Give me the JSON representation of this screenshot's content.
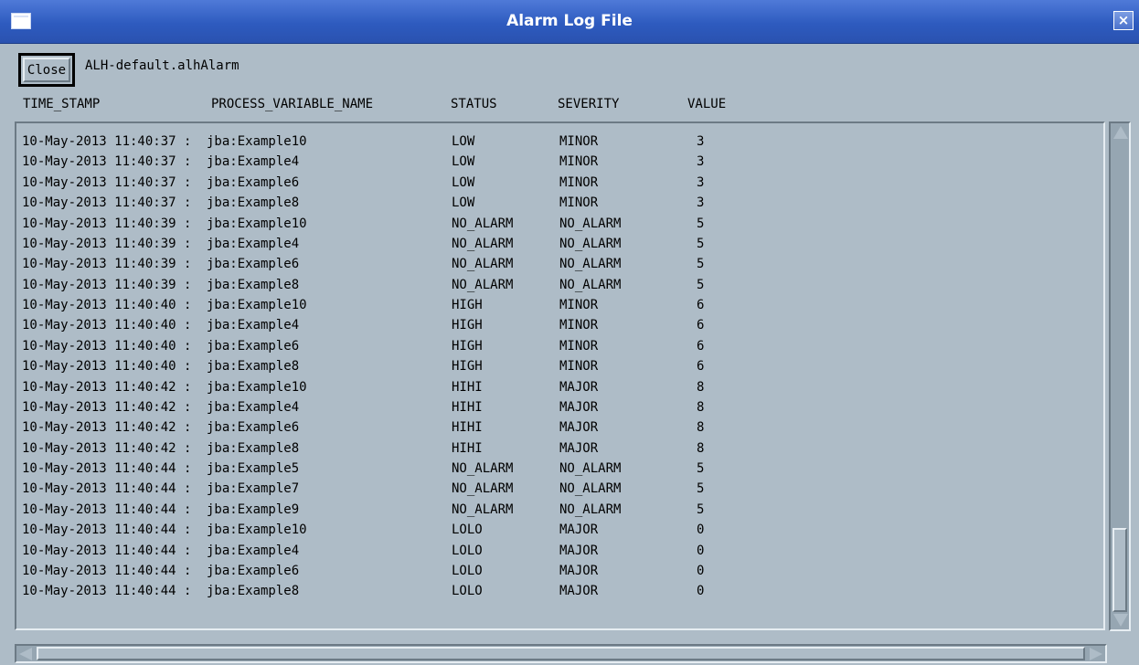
{
  "window": {
    "title": "Alarm Log File",
    "close_glyph": "×",
    "menu_icon": "window-menu-icon"
  },
  "toolbar": {
    "close_label": "Close",
    "filename": "ALH-default.alhAlarm"
  },
  "columns": [
    "TIME_STAMP",
    "PROCESS_VARIABLE_NAME",
    "STATUS",
    "SEVERITY",
    "VALUE"
  ],
  "rows": [
    {
      "time": "10-May-2013 11:40:37 :",
      "pv": "jba:Example10",
      "status": "LOW",
      "severity": "MINOR",
      "value": "3"
    },
    {
      "time": "10-May-2013 11:40:37 :",
      "pv": "jba:Example4",
      "status": "LOW",
      "severity": "MINOR",
      "value": "3"
    },
    {
      "time": "10-May-2013 11:40:37 :",
      "pv": "jba:Example6",
      "status": "LOW",
      "severity": "MINOR",
      "value": "3"
    },
    {
      "time": "10-May-2013 11:40:37 :",
      "pv": "jba:Example8",
      "status": "LOW",
      "severity": "MINOR",
      "value": "3"
    },
    {
      "time": "10-May-2013 11:40:39 :",
      "pv": "jba:Example10",
      "status": "NO_ALARM",
      "severity": "NO_ALARM",
      "value": "5"
    },
    {
      "time": "10-May-2013 11:40:39 :",
      "pv": "jba:Example4",
      "status": "NO_ALARM",
      "severity": "NO_ALARM",
      "value": "5"
    },
    {
      "time": "10-May-2013 11:40:39 :",
      "pv": "jba:Example6",
      "status": "NO_ALARM",
      "severity": "NO_ALARM",
      "value": "5"
    },
    {
      "time": "10-May-2013 11:40:39 :",
      "pv": "jba:Example8",
      "status": "NO_ALARM",
      "severity": "NO_ALARM",
      "value": "5"
    },
    {
      "time": "10-May-2013 11:40:40 :",
      "pv": "jba:Example10",
      "status": "HIGH",
      "severity": "MINOR",
      "value": "6"
    },
    {
      "time": "10-May-2013 11:40:40 :",
      "pv": "jba:Example4",
      "status": "HIGH",
      "severity": "MINOR",
      "value": "6"
    },
    {
      "time": "10-May-2013 11:40:40 :",
      "pv": "jba:Example6",
      "status": "HIGH",
      "severity": "MINOR",
      "value": "6"
    },
    {
      "time": "10-May-2013 11:40:40 :",
      "pv": "jba:Example8",
      "status": "HIGH",
      "severity": "MINOR",
      "value": "6"
    },
    {
      "time": "10-May-2013 11:40:42 :",
      "pv": "jba:Example10",
      "status": "HIHI",
      "severity": "MAJOR",
      "value": "8"
    },
    {
      "time": "10-May-2013 11:40:42 :",
      "pv": "jba:Example4",
      "status": "HIHI",
      "severity": "MAJOR",
      "value": "8"
    },
    {
      "time": "10-May-2013 11:40:42 :",
      "pv": "jba:Example6",
      "status": "HIHI",
      "severity": "MAJOR",
      "value": "8"
    },
    {
      "time": "10-May-2013 11:40:42 :",
      "pv": "jba:Example8",
      "status": "HIHI",
      "severity": "MAJOR",
      "value": "8"
    },
    {
      "time": "10-May-2013 11:40:44 :",
      "pv": "jba:Example5",
      "status": "NO_ALARM",
      "severity": "NO_ALARM",
      "value": "5"
    },
    {
      "time": "10-May-2013 11:40:44 :",
      "pv": "jba:Example7",
      "status": "NO_ALARM",
      "severity": "NO_ALARM",
      "value": "5"
    },
    {
      "time": "10-May-2013 11:40:44 :",
      "pv": "jba:Example9",
      "status": "NO_ALARM",
      "severity": "NO_ALARM",
      "value": "5"
    },
    {
      "time": "10-May-2013 11:40:44 :",
      "pv": "jba:Example10",
      "status": "LOLO",
      "severity": "MAJOR",
      "value": "0"
    },
    {
      "time": "10-May-2013 11:40:44 :",
      "pv": "jba:Example4",
      "status": "LOLO",
      "severity": "MAJOR",
      "value": "0"
    },
    {
      "time": "10-May-2013 11:40:44 :",
      "pv": "jba:Example6",
      "status": "LOLO",
      "severity": "MAJOR",
      "value": "0"
    },
    {
      "time": "10-May-2013 11:40:44 :",
      "pv": "jba:Example8",
      "status": "LOLO",
      "severity": "MAJOR",
      "value": "0"
    }
  ],
  "colors": {
    "titlebar": "#2e5bbf",
    "background": "#aebcc7",
    "text": "#000000"
  }
}
